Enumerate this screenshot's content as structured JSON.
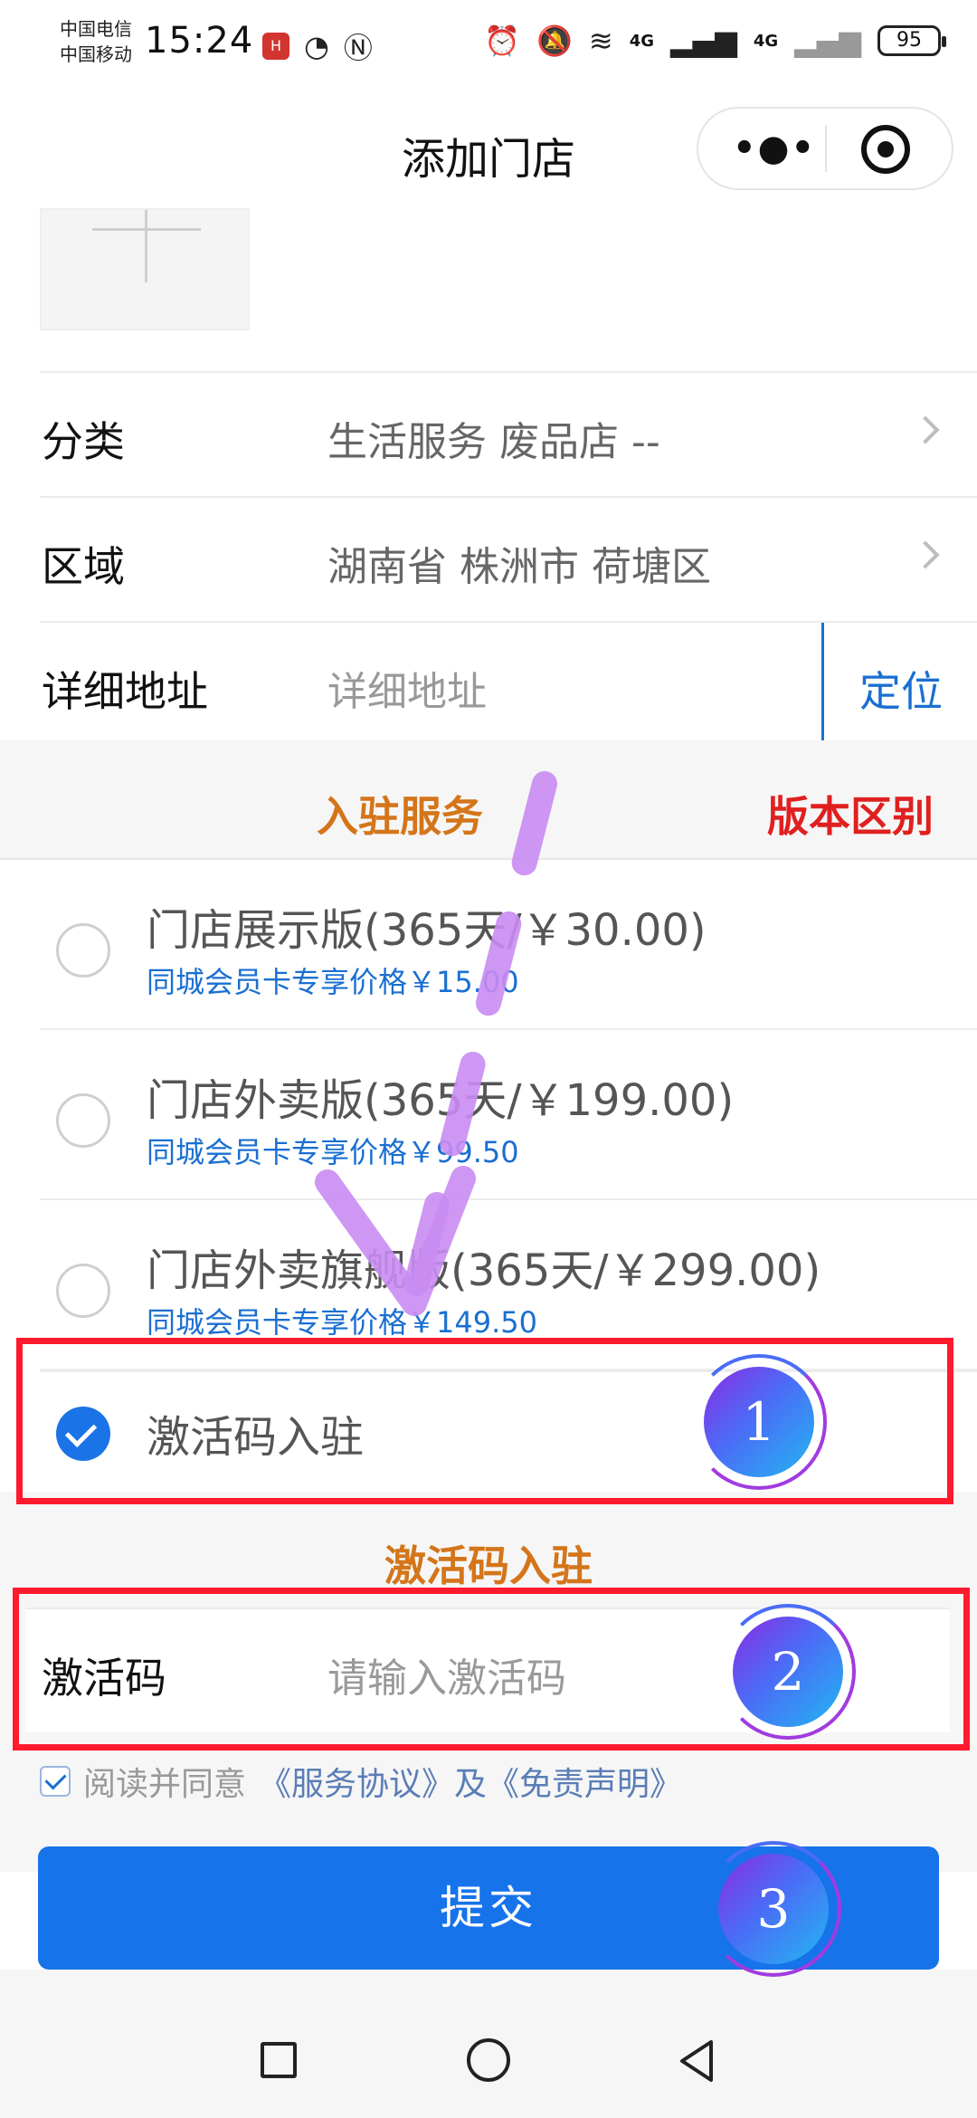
{
  "status_bar": {
    "carrier_1": "中国电信",
    "carrier_2": "中国移动",
    "time": "15:24",
    "battery": "95",
    "network_1": "4G",
    "network_2": "4G"
  },
  "header": {
    "title": "添加门店",
    "more_icon": "more-dots-icon",
    "close_icon": "target-circle-icon"
  },
  "form": {
    "category": {
      "label": "分类",
      "value": "生活服务 废品店 --"
    },
    "region": {
      "label": "区域",
      "value": "湖南省 株洲市 荷塘区"
    },
    "address": {
      "label": "详细地址",
      "placeholder": "详细地址",
      "locate": "定位"
    }
  },
  "service": {
    "title": "入驻服务",
    "diff": "版本区别",
    "plans": [
      {
        "name": "门店展示版(365天/￥30.00)",
        "member": "同城会员卡专享价格￥15.00",
        "checked": false
      },
      {
        "name": "门店外卖版(365天/￥199.00)",
        "member": "同城会员卡专享价格￥99.50",
        "checked": false
      },
      {
        "name": "门店外卖旗舰版(365天/￥299.00)",
        "member": "同城会员卡专享价格￥149.50",
        "checked": false
      },
      {
        "name": "激活码入驻",
        "checked": true
      }
    ]
  },
  "activation": {
    "title": "激活码入驻",
    "label": "激活码",
    "placeholder": "请输入激活码"
  },
  "agreement": {
    "prefix": "阅读并同意",
    "service_link": "《服务协议》",
    "and": "及",
    "disclaimer_link": "《免责声明》",
    "checked": true
  },
  "submit_label": "提交",
  "annotations": {
    "step_1": "1",
    "step_2": "2",
    "step_3": "3",
    "box_color": "#ff1a2e",
    "arrow_color": "#c98cf2"
  },
  "colors": {
    "primary_blue": "#1673ea",
    "link_blue": "#1a6fd1",
    "orange": "#d4751a",
    "red": "#e02020"
  }
}
